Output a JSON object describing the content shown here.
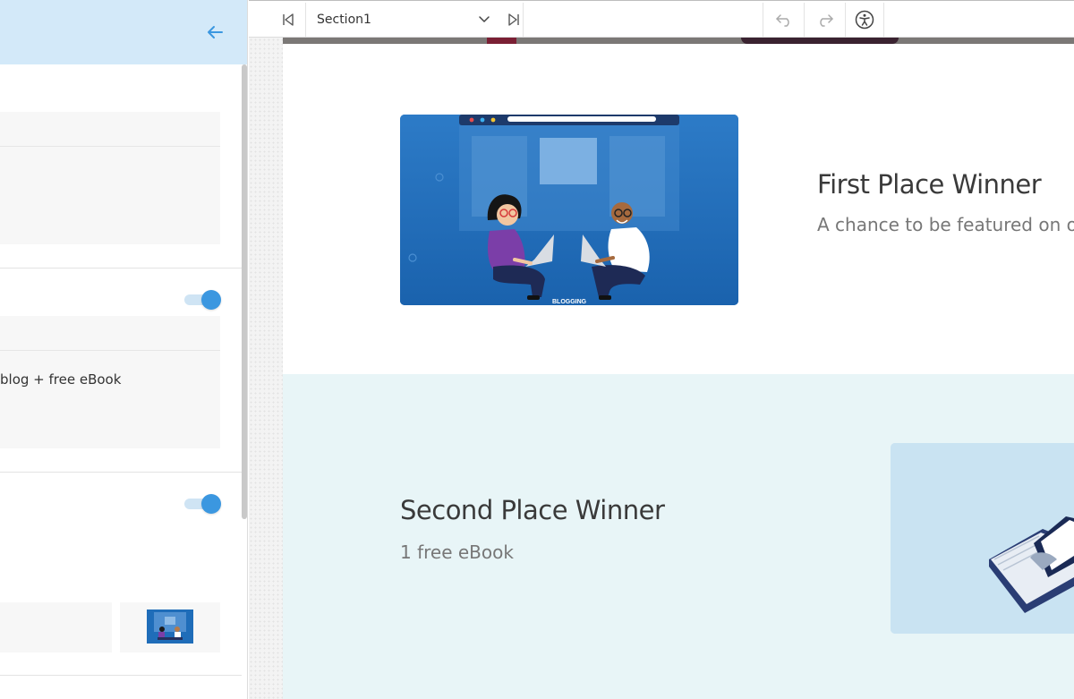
{
  "toolbar": {
    "section_selected": "Section1",
    "icons": [
      "skip-to-start-icon",
      "chevron-down-icon",
      "skip-to-end-icon",
      "undo-icon",
      "redo-icon",
      "accessibility-icon"
    ]
  },
  "panel": {
    "back_icon": "arrow-left-icon",
    "card_text": "blog + free eBook",
    "toggles": [
      true,
      true
    ]
  },
  "canvas": {
    "first": {
      "title": "First Place Winner",
      "description": "A chance to be featured on our",
      "image_caption": "BLOGGING"
    },
    "second": {
      "title": "Second Place Winner",
      "description": "1 free eBook"
    }
  },
  "colors": {
    "accent": "#3b97e0",
    "panel_header": "#d3e9f9",
    "section_alt_bg": "#e8f5f7",
    "illustration_blue": "#1f6db9"
  }
}
